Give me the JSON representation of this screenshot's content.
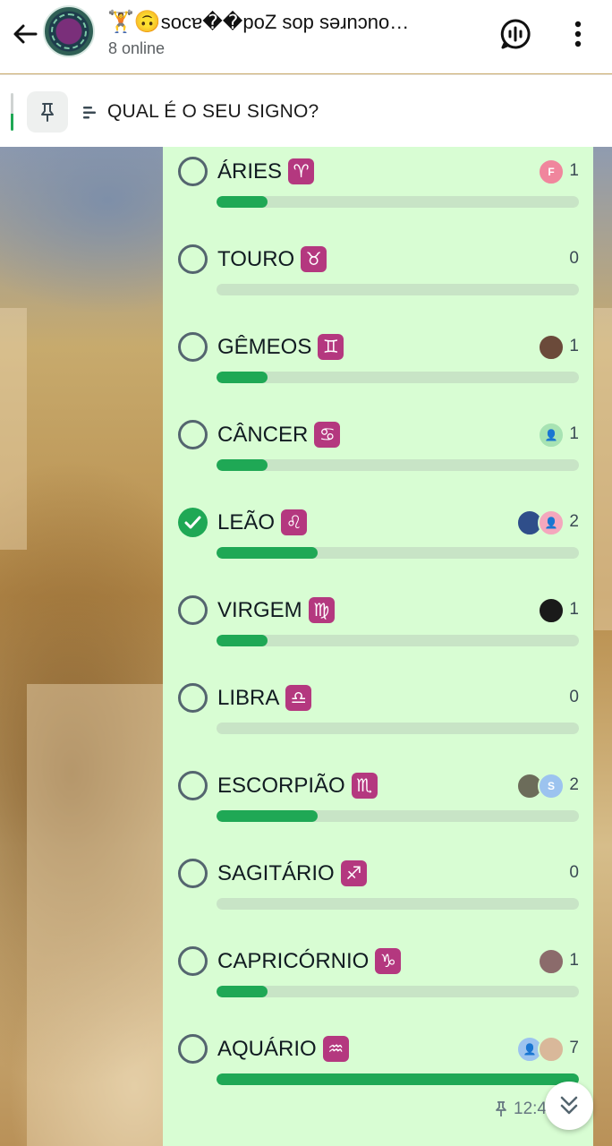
{
  "header": {
    "title_emoji": "🏋️🙃",
    "title": "socɐ��poZ sop sǝɹnɔno…",
    "subtitle": "8 online"
  },
  "pinned": {
    "text": "QUAL É O SEU SIGNO?"
  },
  "poll": {
    "options": [
      {
        "label": "ÁRIES",
        "symbol": "♈",
        "votes": "1",
        "fraction": 0.14,
        "checked": false,
        "voters": [
          {
            "initial": "F",
            "color": "#f0869d"
          }
        ]
      },
      {
        "label": "TOURO",
        "symbol": "♉",
        "votes": "0",
        "fraction": 0,
        "checked": false,
        "voters": []
      },
      {
        "label": "GÊMEOS",
        "symbol": "♊",
        "votes": "1",
        "fraction": 0.14,
        "checked": false,
        "voters": [
          {
            "initial": "",
            "color": "#6b4a3a"
          }
        ]
      },
      {
        "label": "CÂNCER",
        "symbol": "♋",
        "votes": "1",
        "fraction": 0.14,
        "checked": false,
        "voters": [
          {
            "initial": "👤",
            "color": "#a7e3b3"
          }
        ]
      },
      {
        "label": "LEÃO",
        "symbol": "♌",
        "votes": "2",
        "fraction": 0.28,
        "checked": true,
        "voters": [
          {
            "initial": "",
            "color": "#2f4e8a"
          },
          {
            "initial": "👤",
            "color": "#f4a7bd"
          }
        ]
      },
      {
        "label": "VIRGEM",
        "symbol": "♍",
        "votes": "1",
        "fraction": 0.14,
        "checked": false,
        "voters": [
          {
            "initial": "",
            "color": "#1a1a1a"
          }
        ]
      },
      {
        "label": "LIBRA",
        "symbol": "♎",
        "votes": "0",
        "fraction": 0,
        "checked": false,
        "voters": []
      },
      {
        "label": "ESCORPIÃO",
        "symbol": "♏",
        "votes": "2",
        "fraction": 0.28,
        "checked": false,
        "voters": [
          {
            "initial": "",
            "color": "#6c6c5a"
          },
          {
            "initial": "S",
            "color": "#9cc3ef"
          }
        ]
      },
      {
        "label": "SAGITÁRIO",
        "symbol": "♐",
        "votes": "0",
        "fraction": 0,
        "checked": false,
        "voters": []
      },
      {
        "label": "CAPRICÓRNIO",
        "symbol": "♑",
        "votes": "1",
        "fraction": 0.14,
        "checked": false,
        "voters": [
          {
            "initial": "",
            "color": "#8b6b6b"
          }
        ]
      },
      {
        "label": "AQUÁRIO",
        "symbol": "♒",
        "votes": "7",
        "fraction": 1.0,
        "checked": false,
        "voters": [
          {
            "initial": "👤",
            "color": "#9cc3ef"
          },
          {
            "initial": "",
            "color": "#d9b89a"
          }
        ]
      }
    ],
    "time": "12:4"
  }
}
